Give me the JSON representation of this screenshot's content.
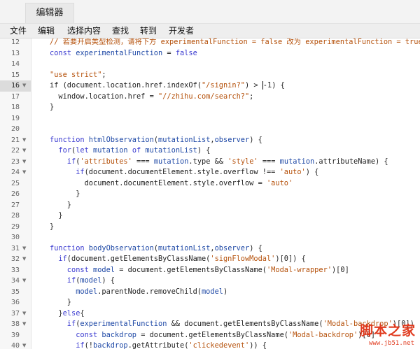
{
  "tab": {
    "label": "编辑器"
  },
  "menu": [
    "文件",
    "编辑",
    "选择内容",
    "查找",
    "转到",
    "开发者"
  ],
  "active_line": "16",
  "lines": [
    {
      "num": "12",
      "fold": false,
      "indent": 0,
      "tokens": [
        {
          "t": "// 若要开启类型检测，请将下方 experimentalFunction = false 改为 experimentalFunction = true",
          "c": "comment"
        }
      ]
    },
    {
      "num": "13",
      "fold": false,
      "indent": 1,
      "tokens": [
        {
          "t": "const ",
          "c": "kw"
        },
        {
          "t": "experimentalFunction",
          "c": "prop"
        },
        {
          "t": " = ",
          "c": "default"
        },
        {
          "t": "false",
          "c": "kw"
        }
      ]
    },
    {
      "num": "14",
      "fold": false,
      "indent": 0,
      "tokens": []
    },
    {
      "num": "15",
      "fold": false,
      "indent": 1,
      "tokens": [
        {
          "t": "\"use strict\"",
          "c": "str"
        },
        {
          "t": ";",
          "c": "default"
        }
      ]
    },
    {
      "num": "16",
      "fold": true,
      "indent": 1,
      "cursor": true,
      "tokens": [
        {
          "t": "if (document.location.href.indexOf(",
          "c": "default"
        },
        {
          "t": "\"/signin?\"",
          "c": "str"
        },
        {
          "t": ") > ",
          "c": "default"
        },
        {
          "t": "-1) {",
          "c": "default",
          "cursor_before": true
        }
      ]
    },
    {
      "num": "17",
      "fold": false,
      "indent": 2,
      "tokens": [
        {
          "t": "window.location.href = ",
          "c": "default"
        },
        {
          "t": "\"//zhihu.com/search?\"",
          "c": "str"
        },
        {
          "t": ";",
          "c": "default"
        }
      ]
    },
    {
      "num": "18",
      "fold": false,
      "indent": 1,
      "tokens": [
        {
          "t": "}",
          "c": "default"
        }
      ]
    },
    {
      "num": "19",
      "fold": false,
      "indent": 0,
      "tokens": []
    },
    {
      "num": "20",
      "fold": false,
      "indent": 0,
      "tokens": []
    },
    {
      "num": "21",
      "fold": true,
      "indent": 1,
      "tokens": [
        {
          "t": "function ",
          "c": "kw"
        },
        {
          "t": "htmlObservation",
          "c": "prop"
        },
        {
          "t": "(",
          "c": "default"
        },
        {
          "t": "mutationList",
          "c": "prop"
        },
        {
          "t": ",",
          "c": "default"
        },
        {
          "t": "observer",
          "c": "prop"
        },
        {
          "t": ") {",
          "c": "default"
        }
      ]
    },
    {
      "num": "22",
      "fold": true,
      "indent": 2,
      "tokens": [
        {
          "t": "for",
          "c": "kw"
        },
        {
          "t": "(",
          "c": "default"
        },
        {
          "t": "let ",
          "c": "kw"
        },
        {
          "t": "mutation ",
          "c": "prop"
        },
        {
          "t": "of ",
          "c": "kw"
        },
        {
          "t": "mutationList",
          "c": "prop"
        },
        {
          "t": ") {",
          "c": "default"
        }
      ]
    },
    {
      "num": "23",
      "fold": true,
      "indent": 3,
      "tokens": [
        {
          "t": "if",
          "c": "kw"
        },
        {
          "t": "(",
          "c": "default"
        },
        {
          "t": "'attributes'",
          "c": "str"
        },
        {
          "t": " === ",
          "c": "default"
        },
        {
          "t": "mutation",
          "c": "prop"
        },
        {
          "t": ".type && ",
          "c": "default"
        },
        {
          "t": "'style'",
          "c": "str"
        },
        {
          "t": " === ",
          "c": "default"
        },
        {
          "t": "mutation",
          "c": "prop"
        },
        {
          "t": ".attributeName) {",
          "c": "default"
        }
      ]
    },
    {
      "num": "24",
      "fold": true,
      "indent": 4,
      "tokens": [
        {
          "t": "if",
          "c": "kw"
        },
        {
          "t": "(document.documentElement.style.overflow !== ",
          "c": "default"
        },
        {
          "t": "'auto'",
          "c": "str"
        },
        {
          "t": ") {",
          "c": "default"
        }
      ]
    },
    {
      "num": "25",
      "fold": false,
      "indent": 5,
      "tokens": [
        {
          "t": "document.documentElement.style.overflow = ",
          "c": "default"
        },
        {
          "t": "'auto'",
          "c": "str"
        }
      ]
    },
    {
      "num": "26",
      "fold": false,
      "indent": 4,
      "tokens": [
        {
          "t": "}",
          "c": "default"
        }
      ]
    },
    {
      "num": "27",
      "fold": false,
      "indent": 3,
      "tokens": [
        {
          "t": "}",
          "c": "default"
        }
      ]
    },
    {
      "num": "28",
      "fold": false,
      "indent": 2,
      "tokens": [
        {
          "t": "}",
          "c": "default"
        }
      ]
    },
    {
      "num": "29",
      "fold": false,
      "indent": 1,
      "tokens": [
        {
          "t": "}",
          "c": "default"
        }
      ]
    },
    {
      "num": "30",
      "fold": false,
      "indent": 0,
      "tokens": []
    },
    {
      "num": "31",
      "fold": true,
      "indent": 1,
      "tokens": [
        {
          "t": "function ",
          "c": "kw"
        },
        {
          "t": "bodyObservation",
          "c": "prop"
        },
        {
          "t": "(",
          "c": "default"
        },
        {
          "t": "mutationList",
          "c": "prop"
        },
        {
          "t": ",",
          "c": "default"
        },
        {
          "t": "observer",
          "c": "prop"
        },
        {
          "t": ") {",
          "c": "default"
        }
      ]
    },
    {
      "num": "32",
      "fold": true,
      "indent": 2,
      "tokens": [
        {
          "t": "if",
          "c": "kw"
        },
        {
          "t": "(document.getElementsByClassName(",
          "c": "default"
        },
        {
          "t": "'signFlowModal'",
          "c": "str"
        },
        {
          "t": ")[0]) {",
          "c": "default"
        }
      ]
    },
    {
      "num": "33",
      "fold": false,
      "indent": 3,
      "tokens": [
        {
          "t": "const ",
          "c": "kw"
        },
        {
          "t": "model",
          "c": "prop"
        },
        {
          "t": " = document.getElementsByClassName(",
          "c": "default"
        },
        {
          "t": "'Modal-wrapper'",
          "c": "str"
        },
        {
          "t": ")[0]",
          "c": "default"
        }
      ]
    },
    {
      "num": "34",
      "fold": true,
      "indent": 3,
      "tokens": [
        {
          "t": "if",
          "c": "kw"
        },
        {
          "t": "(",
          "c": "default"
        },
        {
          "t": "model",
          "c": "prop"
        },
        {
          "t": ") {",
          "c": "default"
        }
      ]
    },
    {
      "num": "35",
      "fold": false,
      "indent": 4,
      "tokens": [
        {
          "t": "model",
          "c": "prop"
        },
        {
          "t": ".parentNode.removeChild(",
          "c": "default"
        },
        {
          "t": "model",
          "c": "prop"
        },
        {
          "t": ")",
          "c": "default"
        }
      ]
    },
    {
      "num": "36",
      "fold": false,
      "indent": 3,
      "tokens": [
        {
          "t": "}",
          "c": "default"
        }
      ]
    },
    {
      "num": "37",
      "fold": true,
      "indent": 2,
      "tokens": [
        {
          "t": "}",
          "c": "default"
        },
        {
          "t": "else",
          "c": "kw"
        },
        {
          "t": "{",
          "c": "default"
        }
      ]
    },
    {
      "num": "38",
      "fold": true,
      "indent": 3,
      "tokens": [
        {
          "t": "if",
          "c": "kw"
        },
        {
          "t": "(",
          "c": "default"
        },
        {
          "t": "experimentalFunction",
          "c": "prop"
        },
        {
          "t": " && document.getElementsByClassName(",
          "c": "default"
        },
        {
          "t": "'Modal-backdrop'",
          "c": "str"
        },
        {
          "t": ")[0])",
          "c": "default"
        }
      ]
    },
    {
      "num": "39",
      "fold": false,
      "indent": 4,
      "tokens": [
        {
          "t": "const ",
          "c": "kw"
        },
        {
          "t": "backdrop",
          "c": "prop"
        },
        {
          "t": " = document.getElementsByClassName(",
          "c": "default"
        },
        {
          "t": "'Modal-backdrop'",
          "c": "str"
        },
        {
          "t": ")[0]",
          "c": "default"
        }
      ]
    },
    {
      "num": "40",
      "fold": true,
      "indent": 4,
      "tokens": [
        {
          "t": "if",
          "c": "kw"
        },
        {
          "t": "(!",
          "c": "default"
        },
        {
          "t": "backdrop",
          "c": "prop"
        },
        {
          "t": ".getAttribute(",
          "c": "default"
        },
        {
          "t": "'clickedevent'",
          "c": "str"
        },
        {
          "t": ")) {",
          "c": "default"
        }
      ]
    }
  ],
  "watermark": {
    "title": "脚本之家",
    "url": "www.jb51.net"
  }
}
